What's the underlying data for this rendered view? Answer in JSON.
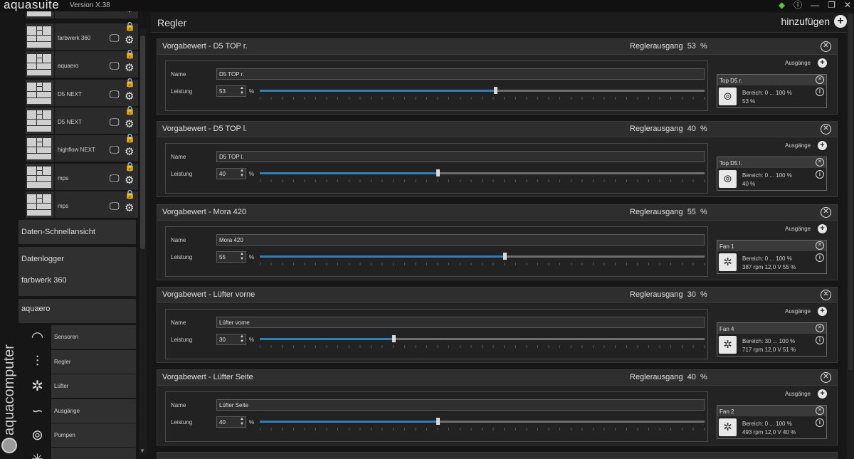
{
  "app": {
    "name": "aquasuite",
    "version": "Version X.38"
  },
  "brand": {
    "text": "aquacomputer"
  },
  "titlebar_icons": [
    "layers-icon",
    "info-icon",
    "minimize-icon",
    "restore-icon",
    "close-icon"
  ],
  "sidebar": {
    "devices": [
      {
        "label": "farbwerk 360"
      },
      {
        "label": "aquaero"
      },
      {
        "label": "D5 NEXT"
      },
      {
        "label": "D5 NEXT"
      },
      {
        "label": "highflow NEXT"
      },
      {
        "label": "mps"
      },
      {
        "label": "mps"
      }
    ],
    "menu": [
      {
        "label": "Daten-Schnellansicht"
      },
      {
        "label": "Datenlogger"
      },
      {
        "label": "farbwerk 360"
      },
      {
        "label": "aquaero"
      }
    ],
    "sub_items": [
      {
        "label": "Sensoren",
        "icon": "gauge-icon"
      },
      {
        "label": "Regler",
        "icon": "sliders-icon"
      },
      {
        "label": "Lüfter",
        "icon": "fan-icon"
      },
      {
        "label": "Ausgänge",
        "icon": "outputs-icon"
      },
      {
        "label": "Pumpen",
        "icon": "pump-icon"
      }
    ]
  },
  "main": {
    "title": "Regler",
    "add_label": "hinzufügen",
    "panels": [
      {
        "title": "Vorgabewert  -  D5 TOP r.",
        "output_label": "Reglerausgang",
        "output_value": "53 %",
        "name_label": "Name",
        "name_value": "D5 TOP r.",
        "power_label": "Leistung",
        "power_value": "53",
        "unit": "%",
        "level": 0.53,
        "outputs_label": "Ausgänge",
        "output_card": {
          "title": "Top D5 r.",
          "range": "Bereich:  0 ... 100  %",
          "value": "53 %",
          "icon": "pump-icon"
        }
      },
      {
        "title": "Vorgabewert  -  D5 TOP l.",
        "output_label": "Reglerausgang",
        "output_value": "40 %",
        "name_label": "Name",
        "name_value": "D5 TOP l.",
        "power_label": "Leistung",
        "power_value": "40",
        "unit": "%",
        "level": 0.4,
        "outputs_label": "Ausgänge",
        "output_card": {
          "title": "Top D5 l.",
          "range": "Bereich:  0 ... 100  %",
          "value": "40 %",
          "icon": "pump-icon"
        }
      },
      {
        "title": "Vorgabewert  -  Mora 420",
        "output_label": "Reglerausgang",
        "output_value": "55 %",
        "name_label": "Name",
        "name_value": "Mora 420",
        "power_label": "Leistung",
        "power_value": "55",
        "unit": "%",
        "level": 0.55,
        "outputs_label": "Ausgänge",
        "output_card": {
          "title": "Fan 1",
          "range": "Bereich:  0 ... 100  %",
          "value": "387 rpm  12,0 V  55 %",
          "icon": "fan-icon"
        }
      },
      {
        "title": "Vorgabewert  -  Lüfter vorne",
        "output_label": "Reglerausgang",
        "output_value": "30 %",
        "name_label": "Name",
        "name_value": "Lüfter vorne",
        "power_label": "Leistung",
        "power_value": "30",
        "unit": "%",
        "level": 0.3,
        "outputs_label": "Ausgänge",
        "output_card": {
          "title": "Fan 4",
          "range": "Bereich:  30 ... 100  %",
          "value": "717 rpm  12,0 V  51 %",
          "icon": "fan-icon"
        }
      },
      {
        "title": "Vorgabewert  -  Lüfter Seite",
        "output_label": "Reglerausgang",
        "output_value": "40 %",
        "name_label": "Name",
        "name_value": "Lüfter Seite",
        "power_label": "Leistung",
        "power_value": "40",
        "unit": "%",
        "level": 0.4,
        "outputs_label": "Ausgänge",
        "output_card": {
          "title": "Fan 2",
          "range": "Bereich:  0 ... 100  %",
          "value": "493 rpm  12,0 V  40 %",
          "icon": "fan-icon"
        }
      }
    ]
  }
}
